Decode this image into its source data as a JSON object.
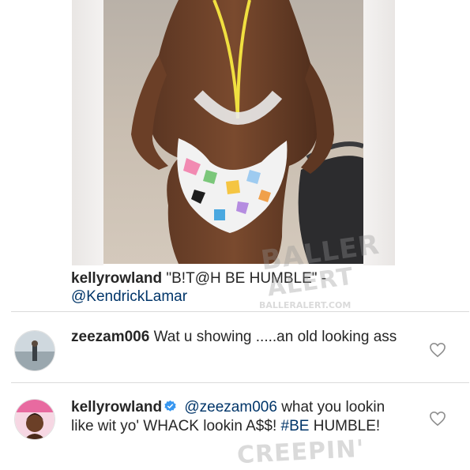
{
  "post": {
    "caption_user": "kellyrowland",
    "caption_text": "\"B!T@H BE HUMBLE\" -",
    "caption_mention": "@KendrickLamar"
  },
  "comments": [
    {
      "user": "zeezam006",
      "text": "Wat u showing .....an old looking ass",
      "verified": false
    },
    {
      "user": "kellyrowland",
      "mention": "@zeezam006",
      "text_1": "what you lookin like wit yo' WHACK lookin A$$!",
      "hashtag": "#BE",
      "text_2": "HUMBLE!",
      "verified": true
    }
  ],
  "watermarks": {
    "brand_top": "BALLER",
    "brand_bottom": "ALERT",
    "url": "BALLERALERT.COM",
    "creeping": "CREEPIN'"
  },
  "colors": {
    "mention": "#003569",
    "verified_badge": "#3897f0",
    "divider": "#dbdbdb"
  },
  "icons": [
    "heart-icon",
    "verified-badge-icon"
  ]
}
